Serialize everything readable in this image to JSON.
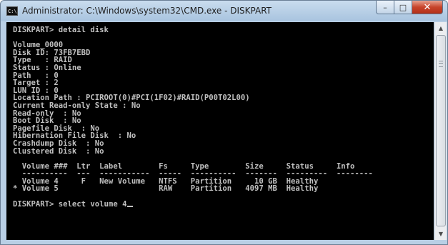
{
  "window": {
    "title": "Administrator: C:\\Windows\\system32\\CMD.exe - DISKPART",
    "icon_name": "cmd-icon",
    "icon_text": "C:\\"
  },
  "caption_buttons": {
    "minimize": "–",
    "maximize": "□",
    "close": "✕"
  },
  "console": {
    "lines": [
      "DISKPART> detail disk",
      "",
      "Volume_0000",
      "Disk ID: 73FB7EBD",
      "Type   : RAID",
      "Status : Online",
      "Path   : 0",
      "Target : 2",
      "LUN ID : 0",
      "Location Path : PCIROOT(0)#PCI(1F02)#RAID(P00T02L00)",
      "Current Read-only State : No",
      "Read-only  : No",
      "Boot Disk  : No",
      "Pagefile Disk  : No",
      "Hibernation File Disk  : No",
      "Crashdump Disk  : No",
      "Clustered Disk  : No",
      "",
      "  Volume ###  Ltr  Label        Fs     Type        Size     Status     Info",
      "  ----------  ---  -----------  -----  ----------  -------  ---------  --------",
      "  Volume 4     F   New Volume   NTFS   Partition     10 GB  Healthy",
      "* Volume 5                      RAW    Partition   4097 MB  Healthy",
      "",
      "DISKPART> select volume 4"
    ]
  },
  "scrollbar": {
    "up_arrow": "▲",
    "down_arrow": "▼"
  }
}
